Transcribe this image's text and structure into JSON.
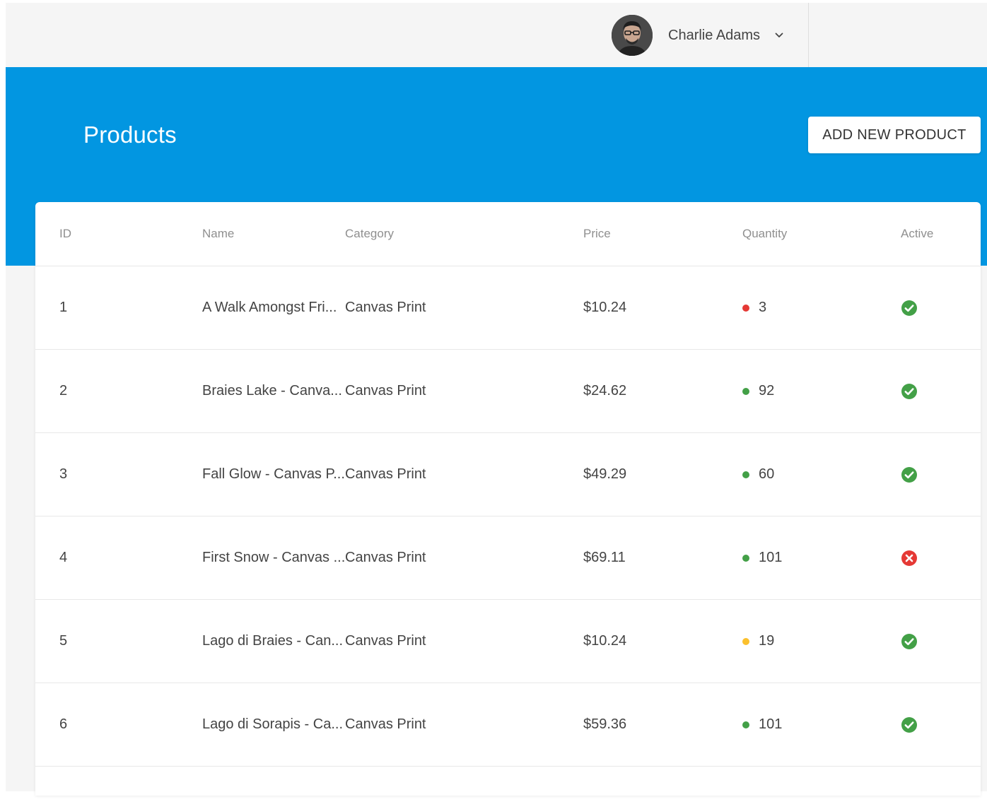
{
  "user": {
    "name": "Charlie Adams"
  },
  "page": {
    "title": "Products",
    "add_button_label": "ADD NEW PRODUCT"
  },
  "table": {
    "columns": {
      "id": "ID",
      "name": "Name",
      "category": "Category",
      "price": "Price",
      "quantity": "Quantity",
      "active": "Active"
    },
    "rows": [
      {
        "id": "1",
        "name": "A Walk Amongst Fri...",
        "category": "Canvas Print",
        "price": "$10.24",
        "quantity": "3",
        "stock_color": "#e53935",
        "active": true
      },
      {
        "id": "2",
        "name": "Braies Lake - Canva...",
        "category": "Canvas Print",
        "price": "$24.62",
        "quantity": "92",
        "stock_color": "#43a047",
        "active": true
      },
      {
        "id": "3",
        "name": "Fall Glow - Canvas P...",
        "category": "Canvas Print",
        "price": "$49.29",
        "quantity": "60",
        "stock_color": "#43a047",
        "active": true
      },
      {
        "id": "4",
        "name": "First Snow - Canvas ...",
        "category": "Canvas Print",
        "price": "$69.11",
        "quantity": "101",
        "stock_color": "#43a047",
        "active": false
      },
      {
        "id": "5",
        "name": "Lago di Braies - Can...",
        "category": "Canvas Print",
        "price": "$10.24",
        "quantity": "19",
        "stock_color": "#fbc02d",
        "active": true
      },
      {
        "id": "6",
        "name": "Lago di Sorapis - Ca...",
        "category": "Canvas Print",
        "price": "$59.36",
        "quantity": "101",
        "stock_color": "#43a047",
        "active": true
      }
    ]
  },
  "colors": {
    "header_blue": "#0296e1",
    "active_green": "#43a047",
    "inactive_red": "#e53935"
  },
  "icons": {
    "active": "check-circle-icon",
    "inactive": "x-circle-icon",
    "user_menu": "chevron-down-icon"
  }
}
